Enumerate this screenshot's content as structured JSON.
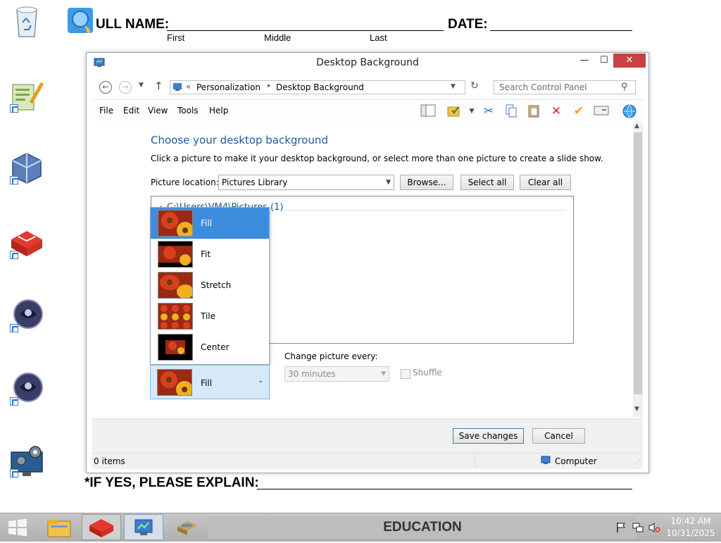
{
  "document": {
    "full_name_label": "ULL NAME:",
    "date_label": "DATE:",
    "first_label": "First",
    "middle_label": "Middle",
    "last_label": "Last",
    "explain_label": "*IF YES, PLEASE EXPLAIN:"
  },
  "window": {
    "title": "Desktop Background",
    "minimize": "—",
    "maximize": "☐",
    "close": "✕",
    "address": {
      "prefix": "«",
      "crumb1": "Personalization",
      "separator": "▸",
      "crumb2": "Desktop Background"
    },
    "search_placeholder": "Search Control Panel",
    "menu": [
      "File",
      "Edit",
      "View",
      "Tools",
      "Help"
    ],
    "heading": "Choose your desktop background",
    "description": "Click a picture to make it your desktop background, or select more than one picture to create a slide show.",
    "picture_location_label": "Picture location:",
    "picture_location_value": "Pictures Library",
    "browse_button": "Browse...",
    "select_all_button": "Select all",
    "clear_all_button": "Clear all",
    "group_header": "C:\\Users\\VM4\\Pictures (1)",
    "position_options": [
      "Fill",
      "Fit",
      "Stretch",
      "Tile",
      "Center"
    ],
    "position_selected": "Fill",
    "change_picture_label": "Change picture every:",
    "change_picture_value": "30 minutes",
    "shuffle_label": "Shuffle",
    "save_button": "Save changes",
    "cancel_button": "Cancel",
    "status_items": "0 items",
    "status_computer": "Computer"
  },
  "taskbar": {
    "label": "EDUCATION",
    "time": "10:42 AM",
    "date": "10/31/2025"
  },
  "colors": {
    "accent_blue": "#1e5a99",
    "selection": "#cce4f7",
    "taskbar": "#c0c0c0",
    "close_red": "#c74343"
  }
}
